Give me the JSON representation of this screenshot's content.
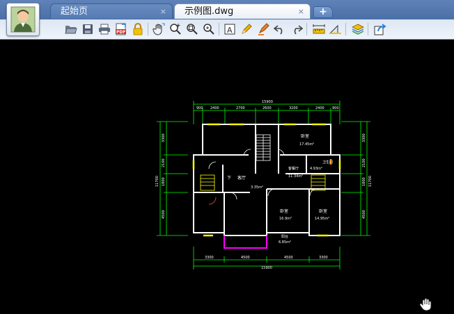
{
  "tabs": [
    {
      "label": "起始页",
      "close": "×"
    },
    {
      "label": "示例图.dwg",
      "close": "×"
    }
  ],
  "new_tab_label": "+",
  "toolbar": {
    "icons": [
      "open-folder-icon",
      "save-icon",
      "print-icon",
      "export-pdf-icon",
      "lock-icon",
      "pan-hand-icon",
      "zoom-in-icon",
      "zoom-window-icon",
      "zoom-extents-icon",
      "text-icon",
      "pencil-icon",
      "highlighter-icon",
      "undo-icon",
      "redo-icon",
      "measure-distance-icon",
      "measure-area-icon",
      "layers-icon",
      "share-icon"
    ]
  },
  "drawing": {
    "top_total": "15900",
    "top_dims": [
      "900",
      "2400",
      "2700",
      "2600",
      "3200",
      "2400",
      "900"
    ],
    "bottom_dims": [
      "3300",
      "4500",
      "4500",
      "3300"
    ],
    "bottom_total": "15900",
    "left_dims": [
      "3300",
      "2100",
      "1800",
      "4500"
    ],
    "left_total": "11700",
    "right_dims": [
      "3300",
      "2100",
      "1800",
      "4500"
    ],
    "right_total": "11700",
    "rooms": [
      {
        "name": "卧室",
        "area": "17.45m²"
      },
      {
        "name": "客厅",
        "area": ""
      },
      {
        "name": "客餐厅",
        "area": "11.34m²"
      },
      {
        "name": "卫生间",
        "area": "4.93m²"
      },
      {
        "name": "卧室",
        "area": "16.9m²"
      },
      {
        "name": "卧室",
        "area": "14.95m²"
      },
      {
        "name": "阳台",
        "area": "6.85m²"
      }
    ],
    "stair_labels": {
      "down": "下",
      "up": "上"
    },
    "small_area": "3.35m²",
    "colors": {
      "walls": "#ffffff",
      "dims": "#00ff00",
      "windows": "#ffff00",
      "balcony": "#ff00ff"
    }
  }
}
